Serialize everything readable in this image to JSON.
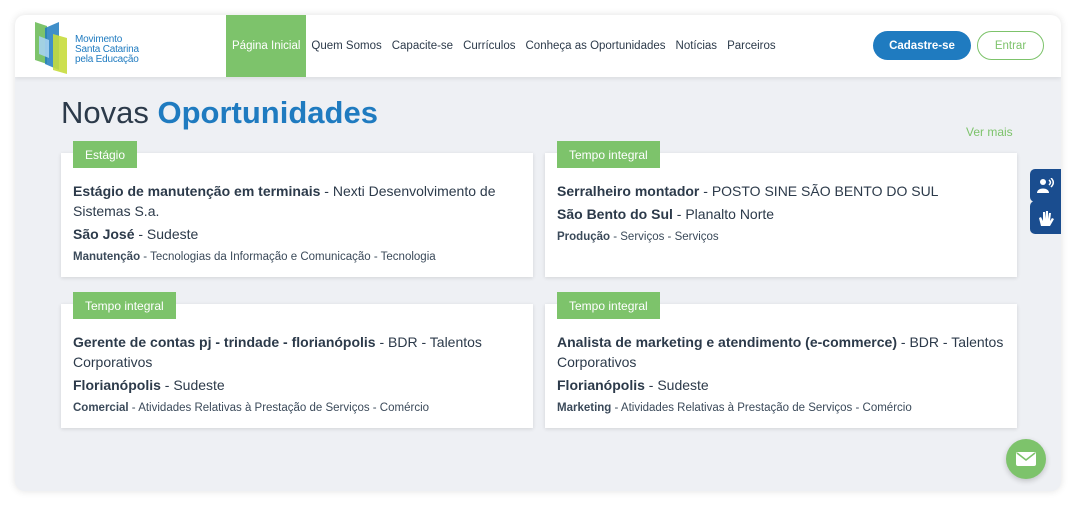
{
  "brand": {
    "lines": [
      "Movimento",
      "Santa Catarina",
      "pela Educação"
    ],
    "colors": {
      "blue": "#1f7bc0",
      "green": "#7dc36b",
      "dark": "#2c3a4a"
    }
  },
  "nav": {
    "items": [
      {
        "label": "Página Inicial",
        "active": true
      },
      {
        "label": "Quem Somos"
      },
      {
        "label": "Capacite-se"
      },
      {
        "label": "Currículos"
      },
      {
        "label": "Conheça as Oportunidades"
      },
      {
        "label": "Notícias"
      },
      {
        "label": "Parceiros"
      }
    ],
    "cadastre_label": "Cadastre-se",
    "entrar_label": "Entrar"
  },
  "section": {
    "title_plain": "Novas",
    "title_highlight": "Oportunidades",
    "ver_mais": "Ver mais"
  },
  "cards": [
    {
      "tag": "Estágio",
      "title": "Estágio de manutenção em terminais",
      "company": " - Nexti Desenvolvimento de Sistemas S.a.",
      "city": "São José",
      "region": " - Sudeste",
      "area": "Manutenção",
      "sectors": " - Tecnologias da Informação e Comunicação - Tecnologia"
    },
    {
      "tag": "Tempo integral",
      "title": "Serralheiro montador",
      "company": " - POSTO SINE SÃO BENTO DO SUL",
      "city": "São Bento do Sul",
      "region": " - Planalto Norte",
      "area": "Produção",
      "sectors": " - Serviços - Serviços"
    },
    {
      "tag": "Tempo integral",
      "title": "Gerente de contas pj - trindade - florianópolis",
      "company": " - BDR - Talentos Corporativos",
      "city": "Florianópolis",
      "region": " - Sudeste",
      "area": "Comercial",
      "sectors": " - Atividades Relativas à Prestação de Serviços - Comércio"
    },
    {
      "tag": "Tempo integral",
      "title": "Analista de marketing e atendimento (e-commerce)",
      "company": " - BDR - Talentos Corporativos",
      "city": "Florianópolis",
      "region": " - Sudeste",
      "area": "Marketing",
      "sectors": " - Atividades Relativas à Prestação de Serviços - Comércio"
    }
  ],
  "accessibility": {
    "audio_icon": "person-speaking-icon",
    "sign_icon": "sign-language-hands-icon"
  },
  "contact": {
    "icon": "envelope-icon"
  }
}
